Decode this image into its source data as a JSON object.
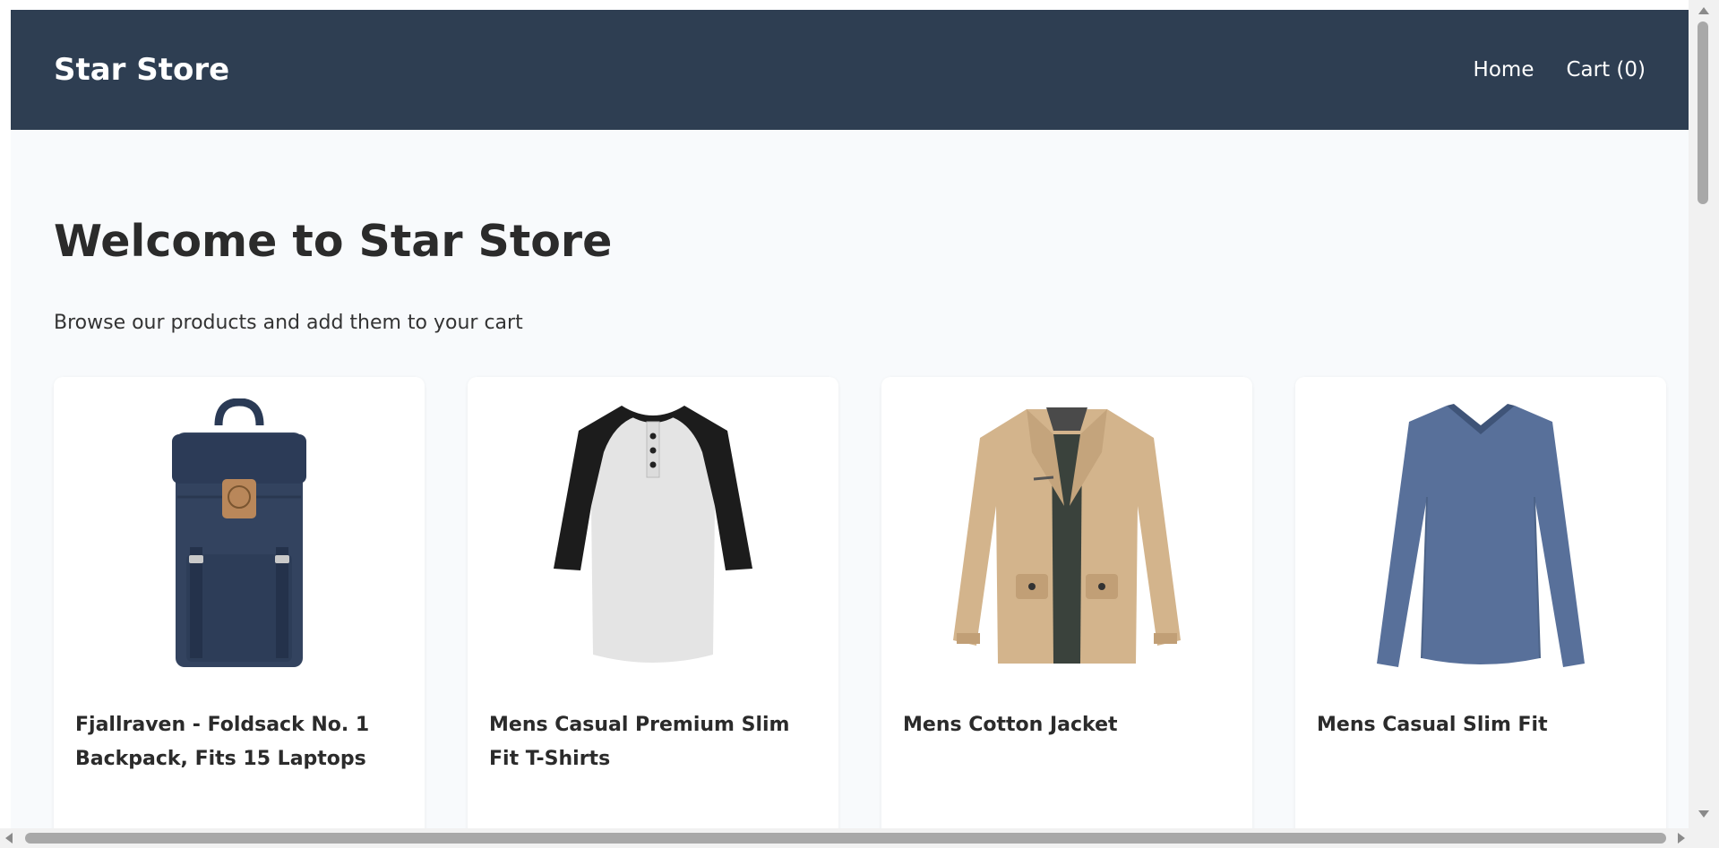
{
  "header": {
    "brand": "Star Store",
    "nav": [
      {
        "label": "Home"
      },
      {
        "label": "Cart (0)"
      }
    ]
  },
  "main": {
    "title": "Welcome to Star Store",
    "subtitle": "Browse our products and add them to your cart"
  },
  "products": [
    {
      "title": "Fjallraven - Foldsack No. 1 Backpack, Fits 15 Laptops",
      "image": "backpack-icon"
    },
    {
      "title": "Mens Casual Premium Slim Fit T-Shirts",
      "image": "raglan-tshirt-icon"
    },
    {
      "title": "Mens Cotton Jacket",
      "image": "jacket-icon"
    },
    {
      "title": "Mens Casual Slim Fit",
      "image": "longsleeve-shirt-icon"
    }
  ],
  "colors": {
    "navbar": "#2e3e52",
    "background": "#f8fafc",
    "card": "#ffffff",
    "text": "#2b2b2b"
  }
}
